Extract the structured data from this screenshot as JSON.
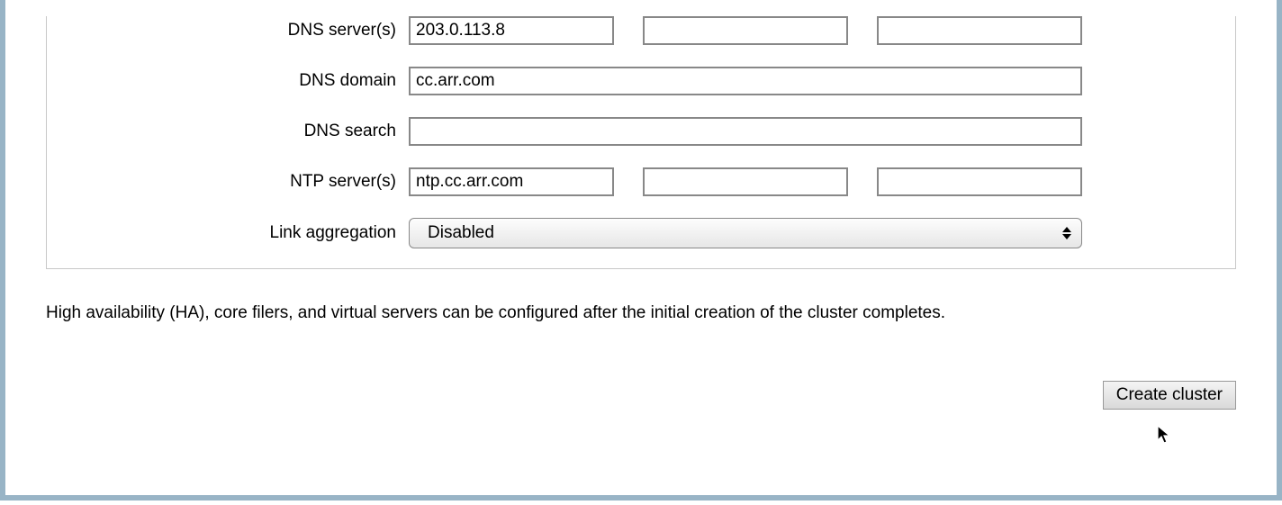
{
  "form": {
    "dns_servers": {
      "label": "DNS server(s)",
      "values": [
        "203.0.113.8",
        "",
        ""
      ]
    },
    "dns_domain": {
      "label": "DNS domain",
      "value": "cc.arr.com"
    },
    "dns_search": {
      "label": "DNS search",
      "value": ""
    },
    "ntp_servers": {
      "label": "NTP server(s)",
      "values": [
        "ntp.cc.arr.com",
        "",
        ""
      ]
    },
    "link_aggregation": {
      "label": "Link aggregation",
      "selected": "Disabled"
    }
  },
  "note": "High availability (HA), core filers, and virtual servers can be configured after the initial creation of the cluster completes.",
  "buttons": {
    "create": "Create cluster"
  }
}
